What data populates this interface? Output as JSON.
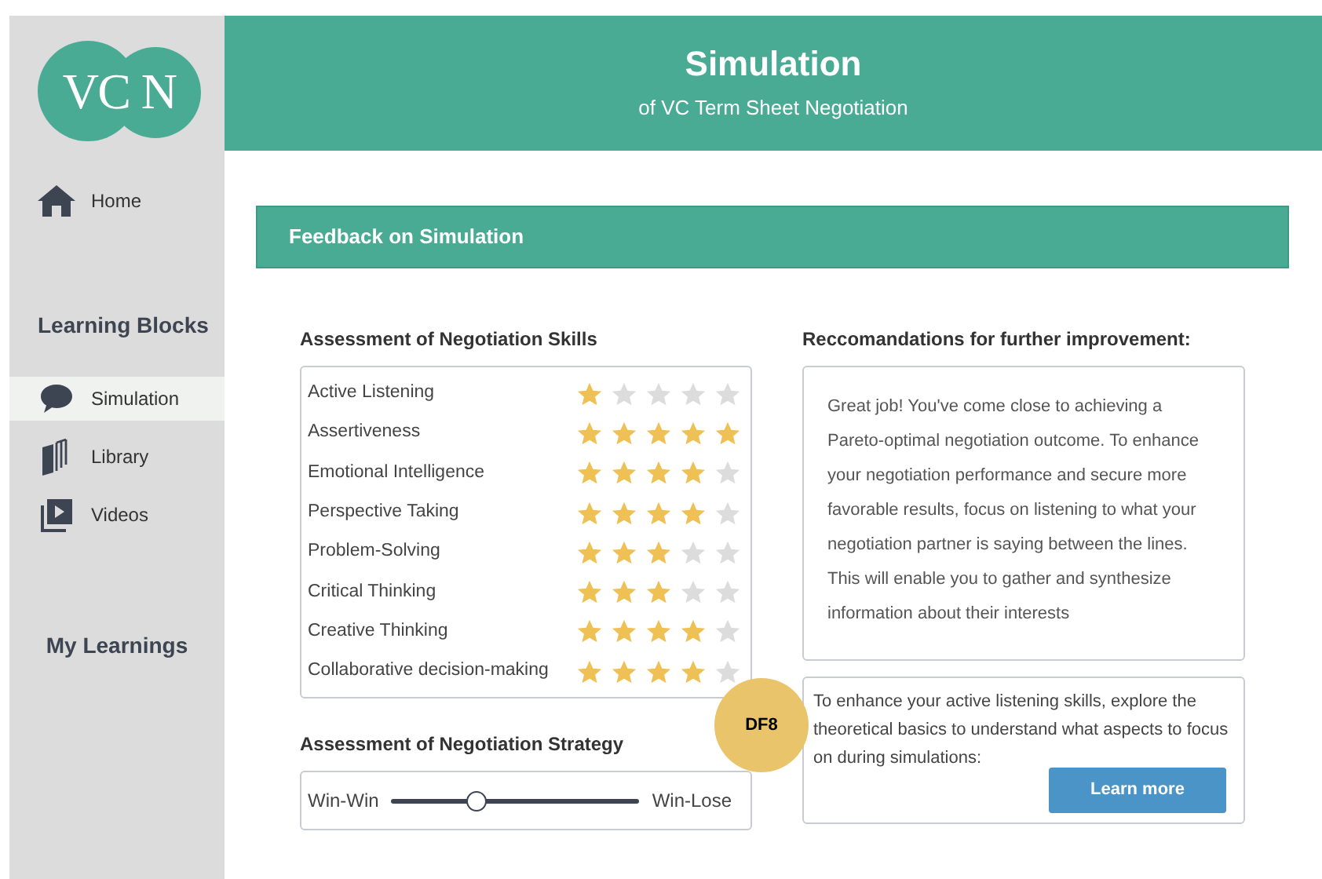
{
  "logo": {
    "text": "VC N"
  },
  "sidebar": {
    "items": [
      {
        "kind": "link",
        "label": "Home",
        "selected": false
      },
      {
        "kind": "heading",
        "label": "Learning Blocks"
      },
      {
        "kind": "link",
        "label": "Simulation",
        "selected": true
      },
      {
        "kind": "link",
        "label": "Library",
        "selected": false
      },
      {
        "kind": "link",
        "label": "Videos",
        "selected": false
      },
      {
        "kind": "heading",
        "label": "My Learnings"
      }
    ]
  },
  "header": {
    "title": "Simulation",
    "subtitle": "of VC Term Sheet Negotiation"
  },
  "feedback_bar": {
    "title": "Feedback on Simulation"
  },
  "skills": {
    "title": "Assessment of Negotiation Skills",
    "rows": [
      {
        "name": "Active Listening",
        "stars": 1
      },
      {
        "name": "Assertiveness",
        "stars": 5
      },
      {
        "name": "Emotional Intelligence",
        "stars": 4
      },
      {
        "name": "Perspective Taking",
        "stars": 4
      },
      {
        "name": "Problem-Solving",
        "stars": 3
      },
      {
        "name": "Critical Thinking",
        "stars": 3
      },
      {
        "name": "Creative Thinking",
        "stars": 4
      },
      {
        "name": "Collaborative decision-making",
        "stars": 4
      }
    ]
  },
  "strategy": {
    "title": "Assessment of Negotiation Strategy",
    "left_label": "Win-Win",
    "right_label": "Win-Lose",
    "level": 0.34
  },
  "recommendations": {
    "title": "Reccomandations for further improvement:",
    "text": "Great job! You've come close to achieving a Pareto-optimal negotiation outcome. To enhance your negotiation performance and secure more favorable results, focus on listening to what your negotiation partner is saying between the lines. This will enable you to gather and synthesize information about their interests",
    "tip": "To enhance your active listening skills, explore the theoretical basics to understand what aspects to focus on during simulations:",
    "button": "Learn more"
  },
  "badge": {
    "text": "DF8"
  }
}
